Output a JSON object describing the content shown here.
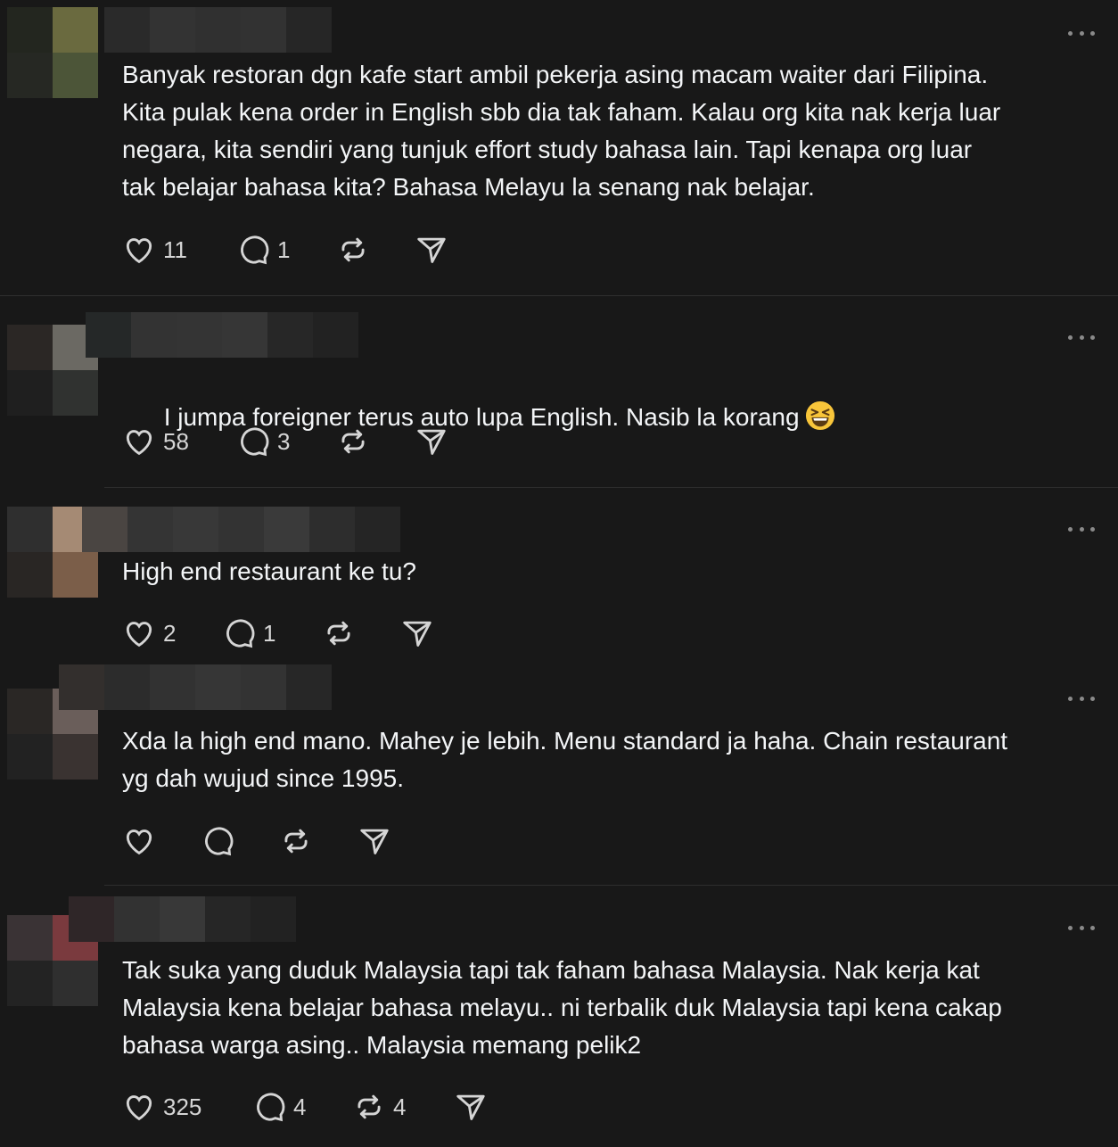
{
  "posts": [
    {
      "text": "Banyak restoran dgn kafe start ambil pekerja asing macam waiter dari Filipina.\nKita pulak kena order in English sbb dia tak faham. Kalau org kita nak kerja luar\nnegara, kita sendiri yang tunjuk effort study bahasa lain. Tapi kenapa org luar\ntak belajar bahasa kita? Bahasa Melayu la senang nak belajar.",
      "likes": "11",
      "replies": "1",
      "reposts": ""
    },
    {
      "text": "I jumpa foreigner terus auto lupa English. Nasib la korang",
      "emoji": "grinning-squinting-face",
      "likes": "58",
      "replies": "3",
      "reposts": ""
    },
    {
      "text": "High end restaurant ke tu?",
      "likes": "2",
      "replies": "1",
      "reposts": ""
    },
    {
      "text": "Xda la high end mano. Mahey je lebih. Menu standard ja haha. Chain restaurant\nyg dah wujud since 1995.",
      "likes": "",
      "replies": "",
      "reposts": ""
    },
    {
      "text": "Tak suka yang duduk Malaysia tapi tak faham bahasa Malaysia. Nak kerja kat\nMalaysia kena belajar bahasa melayu.. ni terbalik duk Malaysia tapi kena cakap\nbahasa warga asing.. Malaysia memang pelik2",
      "likes": "325",
      "replies": "4",
      "reposts": "4"
    }
  ],
  "icons": {
    "like": "heart-icon",
    "reply": "comment-bubble-icon",
    "repost": "repost-icon",
    "share": "send-icon",
    "more": "more-options-icon"
  },
  "colors": {
    "background": "#181818",
    "text": "#f3f5f7",
    "icon": "#d5d5d5",
    "divider": "#2e2e2e"
  }
}
